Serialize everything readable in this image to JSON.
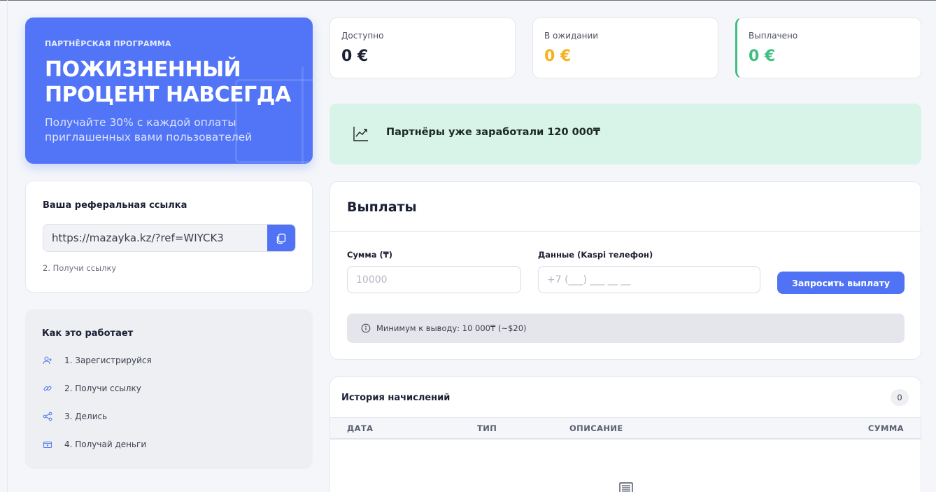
{
  "hero": {
    "kicker": "ПАРТНЁРСКАЯ ПРОГРАММА",
    "title": "ПОЖИЗНЕННЫЙ ПРОЦЕНТ НАВСЕГДА",
    "subtitle": "Получайте 30% с каждой оплаты приглашенных вами пользователей"
  },
  "stats": [
    {
      "label": "Доступно",
      "value": "0 €",
      "color": "#1c2033"
    },
    {
      "label": "В ожидании",
      "value": "0 €",
      "color": "#f5b21b"
    },
    {
      "label": "Выплачено",
      "value": "0 €",
      "color": "#3fbf7f"
    }
  ],
  "banner": {
    "text": "Партнёры уже заработали 120 000₸",
    "icon": "trending-up-icon"
  },
  "referral": {
    "title": "Ваша реферальная ссылка",
    "url": "https://mazayka.kz/?ref=WIYCK3",
    "hint": "2. Получи ссылку",
    "copy_icon": "copy-icon"
  },
  "how": {
    "title": "Как это работает",
    "steps": [
      {
        "text": "1. Зарегистрируйся",
        "icon": "user-plus-icon"
      },
      {
        "text": "2. Получи ссылку",
        "icon": "link-icon"
      },
      {
        "text": "3. Делись",
        "icon": "share-icon"
      },
      {
        "text": "4. Получай деньги",
        "icon": "wallet-icon"
      }
    ]
  },
  "payouts": {
    "title": "Выплаты",
    "amount_label": "Сумма (₸)",
    "amount_placeholder": "10000",
    "phone_label": "Данные (Kaspi телефон)",
    "phone_placeholder": "+7 (___) ___ __ __",
    "request_button": "Запросить выплату",
    "notice": "Минимум к выводу: 10 000₸ (~$20)"
  },
  "history": {
    "title": "История начислений",
    "count": "0",
    "columns": [
      "ДАТА",
      "ТИП",
      "ОПИСАНИЕ",
      "СУММА"
    ]
  },
  "colors": {
    "accent": "#4f73f4",
    "hero_bg": "#5175f6",
    "banner_bg": "#d8f3e7"
  }
}
